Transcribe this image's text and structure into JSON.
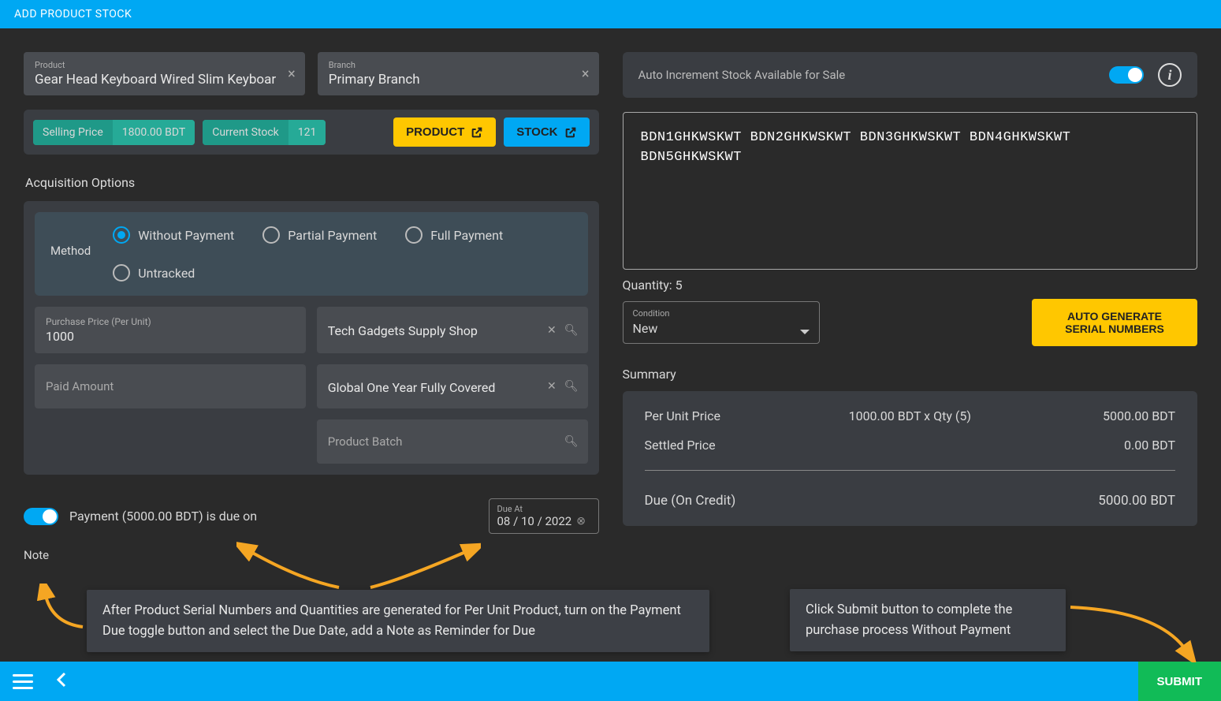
{
  "header": {
    "title": "ADD PRODUCT STOCK"
  },
  "product": {
    "label": "Product",
    "value": "Gear Head Keyboard Wired Slim Keyboar"
  },
  "branch": {
    "label": "Branch",
    "value": "Primary Branch"
  },
  "selling_price": {
    "label": "Selling Price",
    "value": "1800.00 BDT"
  },
  "current_stock": {
    "label": "Current Stock",
    "value": "121"
  },
  "buttons": {
    "product": "PRODUCT",
    "stock": "STOCK",
    "auto_gen": "AUTO GENERATE SERIAL NUMBERS",
    "submit": "SUBMIT"
  },
  "acquisition": {
    "title": "Acquisition Options",
    "method_label": "Method",
    "options": {
      "without_payment": "Without Payment",
      "partial_payment": "Partial Payment",
      "full_payment": "Full Payment",
      "untracked": "Untracked"
    },
    "selected": "without_payment"
  },
  "fields": {
    "purchase_price": {
      "label": "Purchase Price (Per Unit)",
      "value": "1000"
    },
    "supplier": {
      "value": "Tech Gadgets Supply Shop"
    },
    "paid_amount": {
      "placeholder": "Paid Amount"
    },
    "warranty": {
      "value": "Global One Year Fully Covered"
    },
    "product_batch": {
      "placeholder": "Product Batch"
    }
  },
  "payment_due": {
    "toggle_on": true,
    "label": "Payment (5000.00 BDT) is due on",
    "due_at_label": "Due At",
    "due_at_value": "08 / 10 / 2022"
  },
  "note": {
    "label": "Note"
  },
  "auto_increment": {
    "label": "Auto Increment Stock Available for Sale",
    "on": true
  },
  "serials": [
    "BDN1GHKWSKWT",
    "BDN2GHKWSKWT",
    "BDN3GHKWSKWT",
    "BDN4GHKWSKWT",
    "BDN5GHKWSKWT"
  ],
  "quantity_label": "Quantity: 5",
  "condition": {
    "label": "Condition",
    "value": "New"
  },
  "summary": {
    "title": "Summary",
    "rows": [
      {
        "label": "Per Unit Price",
        "mid": "1000.00 BDT x Qty (5)",
        "val": "5000.00 BDT"
      },
      {
        "label": "Settled Price",
        "mid": "",
        "val": "0.00 BDT"
      }
    ],
    "due": {
      "label": "Due (On Credit)",
      "val": "5000.00 BDT"
    }
  },
  "tooltips": {
    "left": "After Product Serial Numbers and Quantities are generated for Per Unit Product, turn on the Payment Due toggle button and select the Due Date, add a Note as Reminder for Due",
    "right": "Click Submit button to complete the purchase process Without Payment"
  }
}
